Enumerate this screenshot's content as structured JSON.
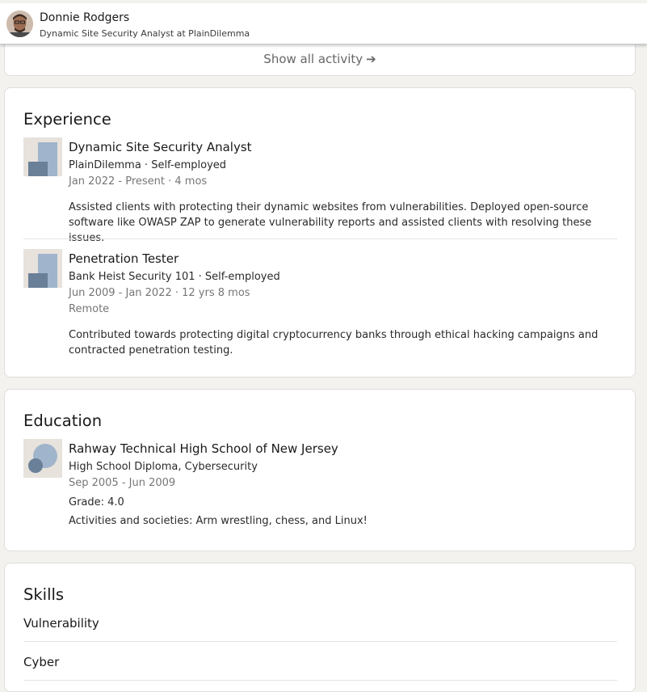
{
  "sticky_header": {
    "name": "Donnie Rodgers",
    "headline": "Dynamic Site Security Analyst at PlainDilemma"
  },
  "activity": {
    "show_all_label": "Show all activity",
    "arrow": "➔"
  },
  "experience": {
    "title": "Experience",
    "items": [
      {
        "role": "Dynamic Site Security Analyst",
        "company": "PlainDilemma · Self-employed",
        "dates": "Jan 2022 - Present · 4 mos",
        "location": "",
        "description": "Assisted clients with protecting their dynamic websites from vulnerabilities. Deployed open-source software like OWASP ZAP to generate vulnerability reports and assisted clients with resolving these issues."
      },
      {
        "role": "Penetration Tester",
        "company": "Bank Heist Security 101 · Self-employed",
        "dates": "Jun 2009 - Jan 2022 · 12 yrs 8 mos",
        "location": "Remote",
        "description": "Contributed towards protecting digital cryptocurrency banks through ethical hacking campaigns and contracted penetration testing."
      }
    ]
  },
  "education": {
    "title": "Education",
    "items": [
      {
        "school": "Rahway Technical High School of New Jersey",
        "degree": "High School Diploma, Cybersecurity",
        "dates": "Sep 2005 - Jun 2009",
        "grade": "Grade: 4.0",
        "activities": "Activities and societies: Arm wrestling, chess, and Linux!"
      }
    ]
  },
  "skills": {
    "title": "Skills",
    "items": [
      "Vulnerability",
      "Cyber"
    ]
  }
}
